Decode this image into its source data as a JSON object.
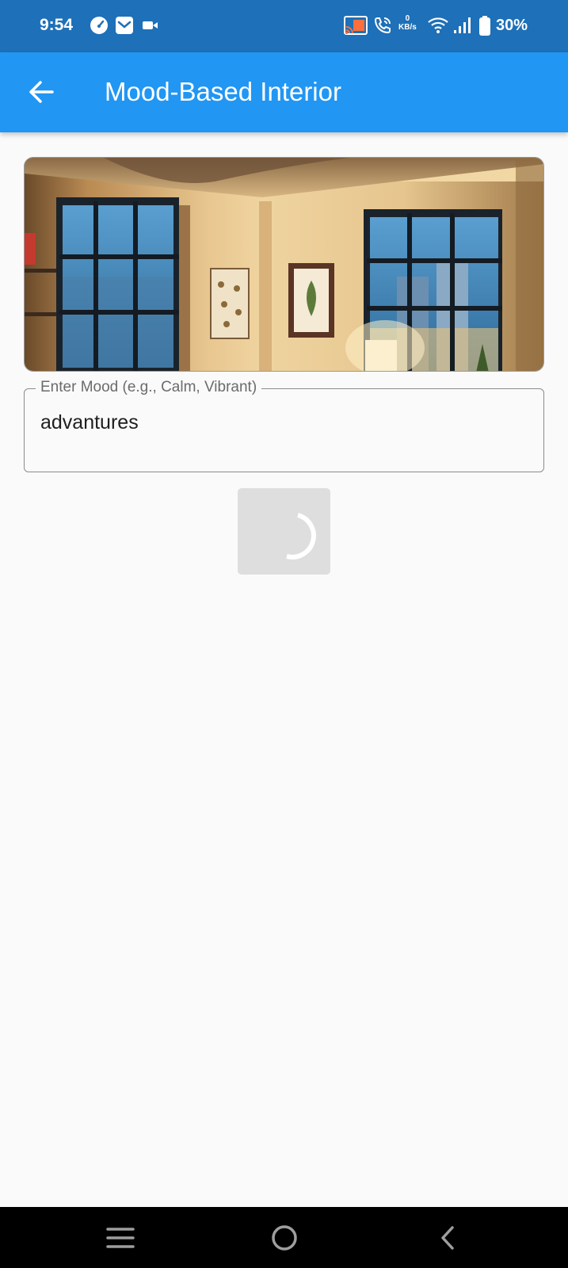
{
  "status_bar": {
    "time": "9:54",
    "network_speed_value": "0",
    "network_speed_unit": "KB/s",
    "battery": "30%",
    "icons": [
      "speedometer-icon",
      "mail-icon",
      "video-camera-icon",
      "cast-icon",
      "wifi-call-icon",
      "wifi-icon",
      "signal-icon",
      "battery-icon"
    ]
  },
  "app_bar": {
    "title": "Mood-Based Interior",
    "back_icon": "arrow-back-icon"
  },
  "mood_input": {
    "label": "Enter Mood (e.g., Calm, Vibrant)",
    "value": "advantures"
  },
  "generate_button": {
    "state": "loading",
    "icon": "loading-spinner-icon"
  },
  "nav_bar": {
    "icons": [
      "recent-apps-icon",
      "home-icon",
      "back-icon"
    ]
  },
  "colors": {
    "status_bar": "#1e70b8",
    "app_bar": "#2196f3",
    "background": "#fafafa",
    "button_loading": "#dedede"
  }
}
